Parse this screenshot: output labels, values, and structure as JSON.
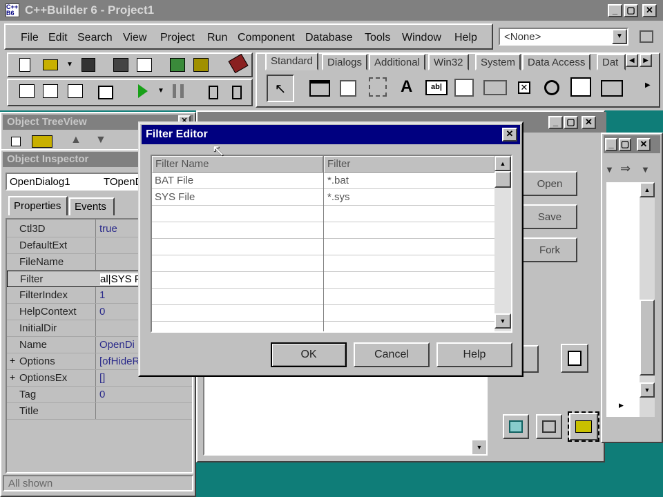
{
  "main_window": {
    "title": "C++Builder 6 - Project1",
    "menu": [
      "File",
      "Edit",
      "Search",
      "View",
      "Project",
      "Run",
      "Component",
      "Database",
      "Tools",
      "Window",
      "Help"
    ],
    "combo_value": "<None>"
  },
  "palette": {
    "tabs": [
      "Standard",
      "Dialogs",
      "Additional",
      "Win32",
      "System",
      "Data Access",
      "Dat"
    ]
  },
  "tree_view": {
    "title": "Object TreeView"
  },
  "inspector": {
    "title": "Object Inspector",
    "object_name": "OpenDialog1",
    "object_type": "TOpenD",
    "tabs": [
      "Properties",
      "Events"
    ],
    "rows": [
      {
        "name": "Ctl3D",
        "value": "true",
        "expand": ""
      },
      {
        "name": "DefaultExt",
        "value": "",
        "expand": ""
      },
      {
        "name": "FileName",
        "value": "",
        "expand": ""
      },
      {
        "name": "Filter",
        "value": "al|SYS F",
        "expand": ""
      },
      {
        "name": "FilterIndex",
        "value": "1",
        "expand": ""
      },
      {
        "name": "HelpContext",
        "value": "0",
        "expand": ""
      },
      {
        "name": "InitialDir",
        "value": "",
        "expand": ""
      },
      {
        "name": "Name",
        "value": "OpenDi",
        "expand": ""
      },
      {
        "name": "Options",
        "value": "[ofHideR",
        "expand": "+"
      },
      {
        "name": "OptionsEx",
        "value": "[]",
        "expand": "+"
      },
      {
        "name": "Tag",
        "value": "0",
        "expand": ""
      },
      {
        "name": "Title",
        "value": "",
        "expand": ""
      }
    ],
    "status": "All shown"
  },
  "form": {
    "buttons": [
      "Open",
      "Save",
      "Fork"
    ]
  },
  "dialog": {
    "title": "Filter Editor",
    "columns": [
      "Filter Name",
      "Filter"
    ],
    "rows": [
      {
        "name": "BAT File",
        "filter": "*.bat"
      },
      {
        "name": "SYS File",
        "filter": "*.sys"
      }
    ],
    "buttons": {
      "ok": "OK",
      "cancel": "Cancel",
      "help": "Help"
    }
  },
  "colors": {
    "desktop": "#0f7d78",
    "active_title": "#000080",
    "inactive_title": "#808080"
  }
}
